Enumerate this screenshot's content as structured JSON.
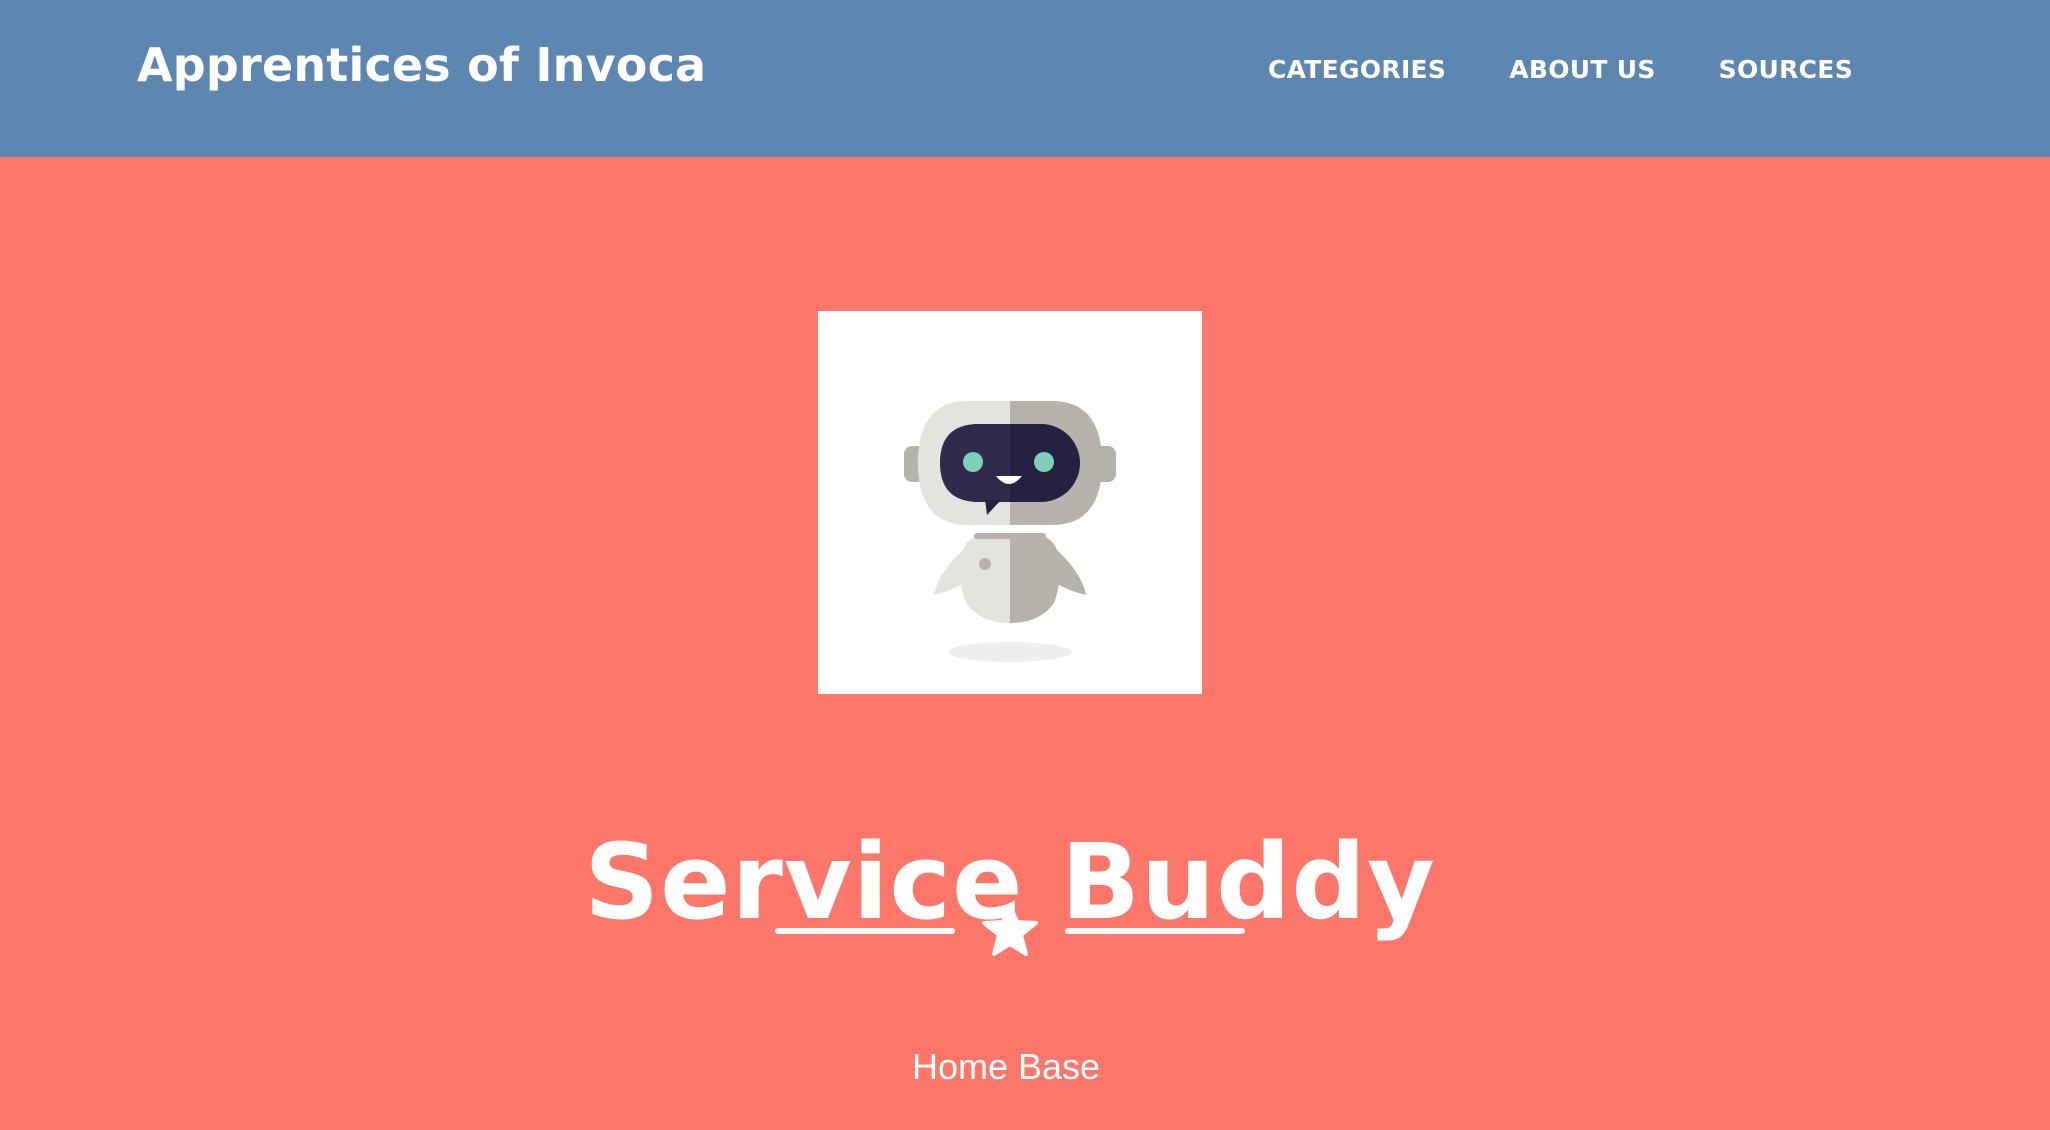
{
  "navbar": {
    "brand": "Apprentices of Invoca",
    "links": [
      {
        "label": "CATEGORIES"
      },
      {
        "label": "ABOUT US"
      },
      {
        "label": "SOURCES"
      }
    ]
  },
  "masthead": {
    "title": "Service Buddy",
    "subtitle": "Home Base",
    "avatar_icon": "robot-icon",
    "divider_icon": "star-icon"
  },
  "colors": {
    "navbar_bg": "#5d86b0",
    "masthead_bg": "#fd766a",
    "text": "#ffffff"
  }
}
